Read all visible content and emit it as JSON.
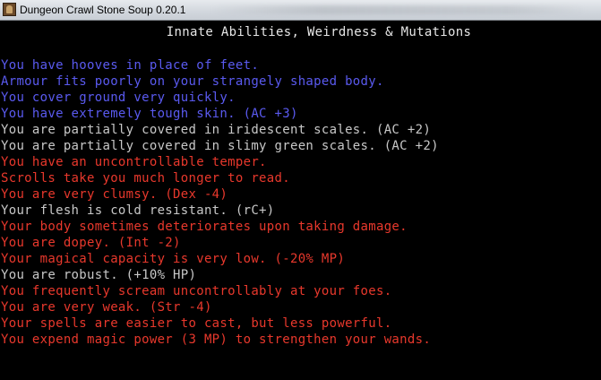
{
  "window": {
    "title": "Dungeon Crawl Stone Soup 0.20.1"
  },
  "screen": {
    "heading": "Innate Abilities, Weirdness & Mutations",
    "lines": [
      {
        "text": "You have hooves in place of feet.",
        "color": "blue"
      },
      {
        "text": "Armour fits poorly on your strangely shaped body.",
        "color": "blue"
      },
      {
        "text": "You cover ground very quickly.",
        "color": "blue"
      },
      {
        "text": "You have extremely tough skin. (AC +3)",
        "color": "blue"
      },
      {
        "text": "You are partially covered in iridescent scales. (AC +2)",
        "color": "gray"
      },
      {
        "text": "You are partially covered in slimy green scales. (AC +2)",
        "color": "gray"
      },
      {
        "text": "You have an uncontrollable temper.",
        "color": "red"
      },
      {
        "text": "Scrolls take you much longer to read.",
        "color": "red"
      },
      {
        "text": "You are very clumsy. (Dex -4)",
        "color": "red"
      },
      {
        "text": "Your flesh is cold resistant. (rC+)",
        "color": "gray"
      },
      {
        "text": "Your body sometimes deteriorates upon taking damage.",
        "color": "red"
      },
      {
        "text": "You are dopey. (Int -2)",
        "color": "red"
      },
      {
        "text": "Your magical capacity is very low. (-20% MP)",
        "color": "red"
      },
      {
        "text": "You are robust. (+10% HP)",
        "color": "gray"
      },
      {
        "text": "You frequently scream uncontrollably at your foes.",
        "color": "red"
      },
      {
        "text": "You are very weak. (Str -4)",
        "color": "red"
      },
      {
        "text": "Your spells are easier to cast, but less powerful.",
        "color": "red"
      },
      {
        "text": "You expend magic power (3 MP) to strengthen your wands.",
        "color": "red"
      }
    ]
  },
  "colors": {
    "blue": "#5a5af0",
    "gray": "#c8c8c8",
    "red": "#e8382c",
    "background": "#000000"
  }
}
